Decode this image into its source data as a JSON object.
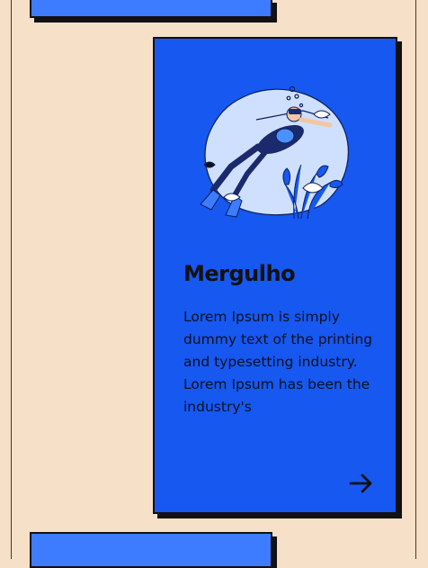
{
  "card": {
    "title": "Mergulho",
    "description": "Lorem Ipsum is simply dummy text of the printing and typesetting industry. Lorem Ipsum has been the industry's",
    "arrow_icon": "arrow-right-icon",
    "illustration": "scuba-diver-illustration"
  },
  "colors": {
    "background": "#f7e0c8",
    "card": "#1658f0",
    "strip": "#3e7cff",
    "shadow": "#111111"
  }
}
